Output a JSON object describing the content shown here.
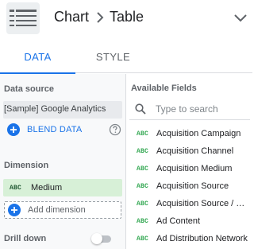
{
  "header": {
    "breadcrumb_chart": "Chart",
    "breadcrumb_table": "Table"
  },
  "tabs": [
    {
      "label": "DATA",
      "active": true
    },
    {
      "label": "STYLE",
      "active": false
    }
  ],
  "data_source": {
    "title": "Data source",
    "value": "[Sample] Google Analytics",
    "blend_label": "BLEND DATA"
  },
  "dimension": {
    "title": "Dimension",
    "type_badge": "ABC",
    "chip_label": "Medium",
    "add_label": "Add dimension"
  },
  "drill_down": {
    "title": "Drill down",
    "enabled": false
  },
  "available_fields": {
    "title": "Available Fields",
    "search_placeholder": "Type to search",
    "type_badge": "ABC",
    "items": [
      "Acquisition Campaign",
      "Acquisition Channel",
      "Acquisition Medium",
      "Acquisition Source",
      "Acquisition Source / Medium",
      "Ad Content",
      "Ad Distribution Network"
    ]
  },
  "colors": {
    "accent": "#1a73e8",
    "dimension_chip": "#d7f0d7",
    "field_badge": "#34a853"
  },
  "icons": {
    "chart_type": "table-chart-icon",
    "breadcrumb_separator": "chevron-right-icon",
    "collapse": "chevron-down-icon",
    "blend": "plus-circle-icon",
    "help": "help-icon",
    "search": "search-icon"
  }
}
